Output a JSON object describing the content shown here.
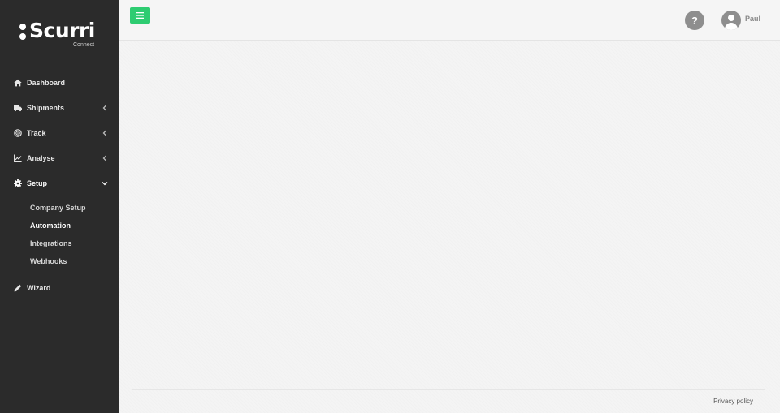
{
  "brand": {
    "name": "Scurri",
    "subtitle": "Connect",
    "accent_color": "#2ecc71",
    "sidebar_color": "#2b2b2b"
  },
  "sidebar": {
    "items": [
      {
        "label": "Dashboard",
        "icon": "home-icon",
        "has_chevron": false
      },
      {
        "label": "Shipments",
        "icon": "truck-icon",
        "has_chevron": true,
        "expanded": false
      },
      {
        "label": "Track",
        "icon": "target-icon",
        "has_chevron": true,
        "expanded": false
      },
      {
        "label": "Analyse",
        "icon": "line-chart-icon",
        "has_chevron": true,
        "expanded": false
      },
      {
        "label": "Setup",
        "icon": "gear-icon",
        "has_chevron": true,
        "expanded": true
      },
      {
        "label": "Wizard",
        "icon": "pencil-icon",
        "has_chevron": false
      }
    ],
    "setup_subitems": [
      {
        "label": "Company Setup",
        "active": false
      },
      {
        "label": "Automation",
        "active": true
      },
      {
        "label": "Integrations",
        "active": false
      },
      {
        "label": "Webhooks",
        "active": false
      }
    ]
  },
  "topbar": {
    "menu_icon": "hamburger-icon",
    "help_label": "?",
    "user_name": "Paul"
  },
  "footer": {
    "privacy_link": "Privacy policy"
  }
}
